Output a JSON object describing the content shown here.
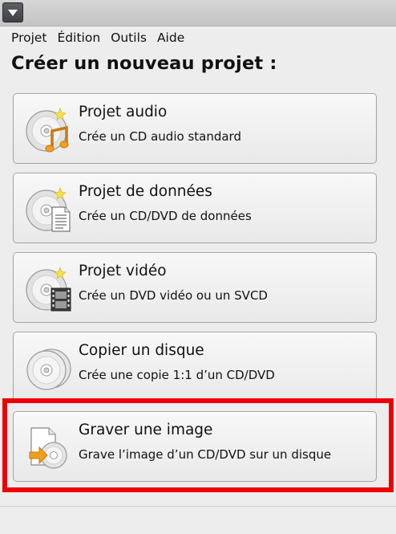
{
  "menubar": {
    "items": [
      "Projet",
      "Édition",
      "Outils",
      "Aide"
    ]
  },
  "page_title": "Créer un nouveau projet :",
  "projects": [
    {
      "title": "Projet audio",
      "description": "Crée un CD audio standard",
      "icon": "audio-cd-icon"
    },
    {
      "title": "Projet de données",
      "description": "Crée un CD/DVD de données",
      "icon": "data-disc-icon"
    },
    {
      "title": "Projet vidéo",
      "description": "Crée un DVD vidéo ou un SVCD",
      "icon": "video-disc-icon"
    },
    {
      "title": "Copier un disque",
      "description": "Crée une copie 1:1 d’un CD/DVD",
      "icon": "copy-disc-icon"
    },
    {
      "title": "Graver une image",
      "description": "Grave l’image d’un CD/DVD sur un disque",
      "icon": "burn-image-icon"
    }
  ],
  "colors": {
    "highlight": "#ee0000",
    "note_orange": "#f0a020",
    "star_yellow": "#f5e04a"
  }
}
